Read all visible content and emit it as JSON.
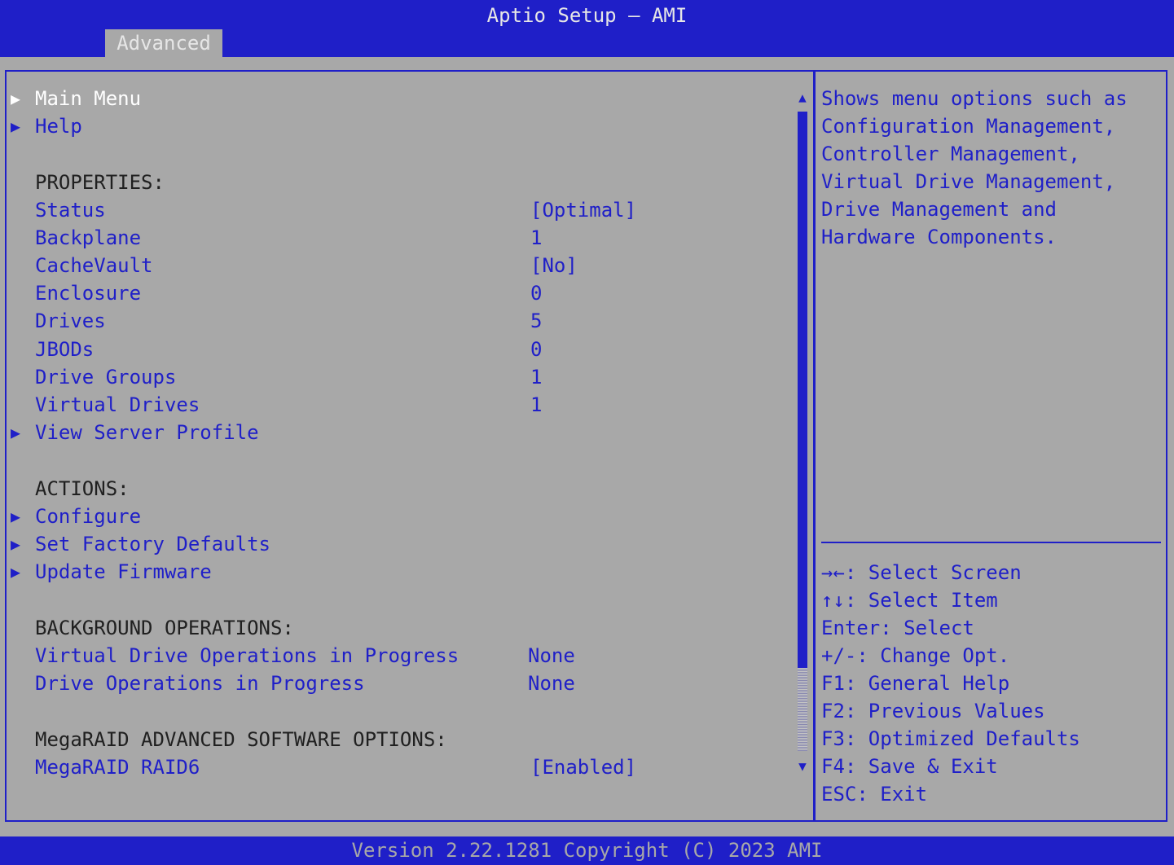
{
  "header": {
    "title": "Aptio Setup – AMI",
    "tab": "Advanced"
  },
  "menu": [
    {
      "name": "main-menu-item",
      "type": "submenu",
      "label": "Main Menu",
      "selected": true
    },
    {
      "name": "help-item",
      "type": "submenu",
      "label": "Help"
    },
    {
      "name": "properties-heading",
      "type": "heading",
      "label": "PROPERTIES:"
    },
    {
      "name": "status-row",
      "type": "value",
      "label": "Status",
      "value": "[Optimal]",
      "valcol": 651
    },
    {
      "name": "backplane-row",
      "type": "value",
      "label": "Backplane",
      "value": "1",
      "valcol": 651
    },
    {
      "name": "cachevault-row",
      "type": "value",
      "label": "CacheVault",
      "value": "[No]",
      "valcol": 651
    },
    {
      "name": "enclosure-row",
      "type": "value",
      "label": "Enclosure",
      "value": "0",
      "valcol": 651
    },
    {
      "name": "drives-row",
      "type": "value",
      "label": "Drives",
      "value": "5",
      "valcol": 651
    },
    {
      "name": "jbods-row",
      "type": "value",
      "label": "JBODs",
      "value": "0",
      "valcol": 651
    },
    {
      "name": "drive-groups-row",
      "type": "value",
      "label": "Drive Groups",
      "value": "1",
      "valcol": 651
    },
    {
      "name": "virtual-drives-row",
      "type": "value",
      "label": "Virtual Drives",
      "value": "1",
      "valcol": 651
    },
    {
      "name": "view-server-profile-item",
      "type": "submenu",
      "label": "View Server Profile"
    },
    {
      "name": "actions-heading",
      "type": "heading",
      "label": "ACTIONS:"
    },
    {
      "name": "configure-item",
      "type": "submenu",
      "label": "Configure"
    },
    {
      "name": "set-factory-defaults-item",
      "type": "submenu",
      "label": "Set Factory Defaults"
    },
    {
      "name": "update-firmware-item",
      "type": "submenu",
      "label": "Update Firmware"
    },
    {
      "name": "background-operations-heading",
      "type": "heading",
      "label": "BACKGROUND OPERATIONS:"
    },
    {
      "name": "vd-operations-row",
      "type": "value",
      "label": "Virtual Drive Operations in Progress",
      "value": "None",
      "valcol": 648
    },
    {
      "name": "drive-operations-row",
      "type": "value",
      "label": "Drive Operations in Progress",
      "value": "None",
      "valcol": 648
    },
    {
      "name": "software-options-heading",
      "type": "heading",
      "label": "MegaRAID ADVANCED SOFTWARE OPTIONS:"
    },
    {
      "name": "megaraid-raid6-row",
      "type": "option",
      "label": "MegaRAID RAID6",
      "value": "[Enabled]",
      "valcol": 651
    }
  ],
  "help_text": [
    "Shows menu options such as",
    "Configuration Management,",
    "Controller Management,",
    "Virtual Drive Management,",
    "Drive Management and",
    "Hardware Components."
  ],
  "keys": [
    "→←: Select Screen",
    "↑↓: Select Item",
    "Enter: Select",
    "+/-: Change Opt.",
    "F1: General Help",
    "F2: Previous Values",
    "F3: Optimized Defaults",
    "F4: Save & Exit",
    "ESC: Exit"
  ],
  "scrollbar": {
    "thumb_fraction": 0.87,
    "up_glyph": "▲",
    "down_glyph": "▼"
  },
  "footer": {
    "text": "Version 2.22.1281 Copyright (C) 2023 AMI"
  },
  "colors": {
    "accent": "#1f1fc8",
    "background": "#a8a8a8",
    "selected_text": "#ffffff"
  }
}
